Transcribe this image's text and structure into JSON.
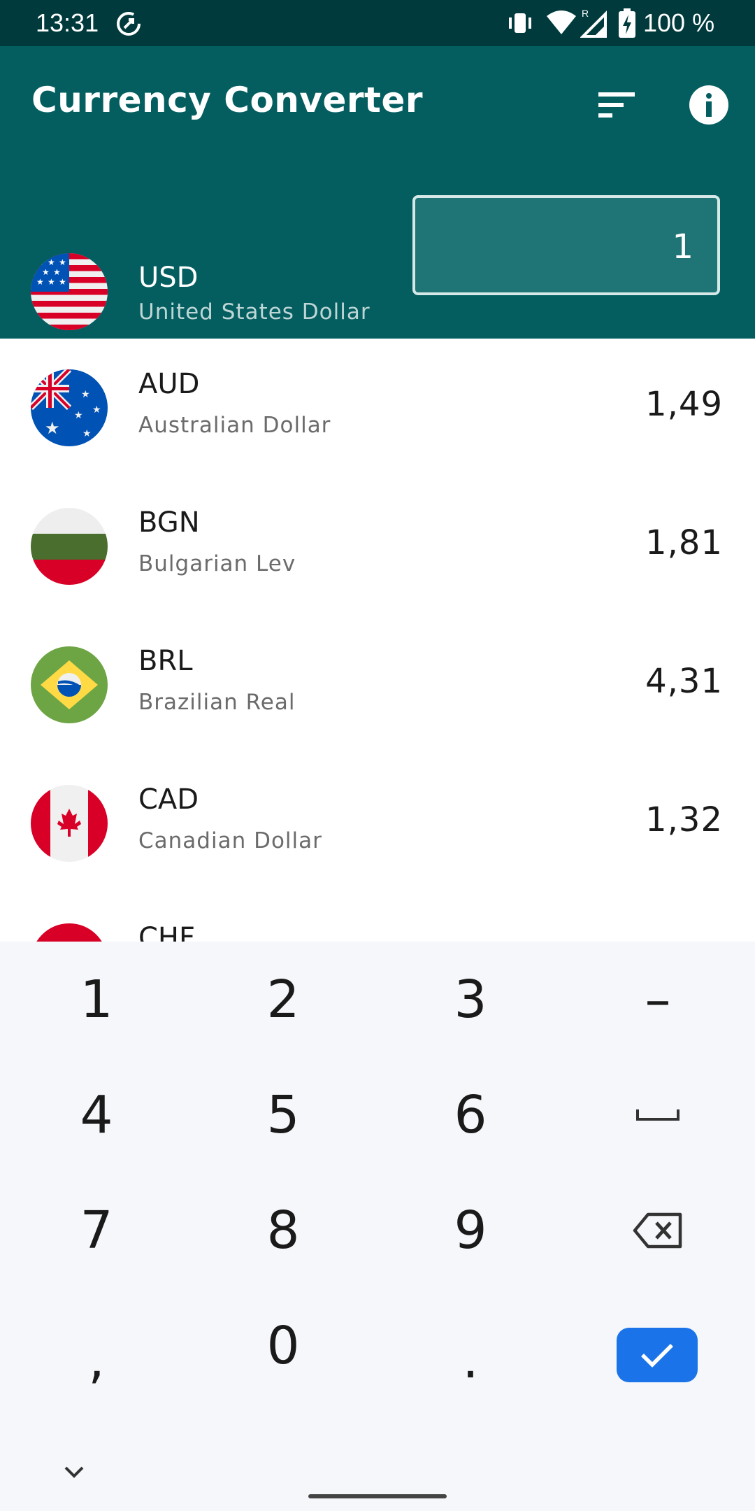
{
  "status_bar": {
    "time": "13:31",
    "battery": "100 %",
    "icons": [
      "data-saver-icon",
      "vibrate-icon",
      "wifi-icon",
      "signal-roaming-icon",
      "battery-charging-icon"
    ]
  },
  "app_bar": {
    "title": "Currency Converter",
    "actions": [
      "sort-icon",
      "info-icon"
    ],
    "color": "#045e60"
  },
  "base_currency": {
    "code": "USD",
    "name": "United States Dollar",
    "amount": "1",
    "flag": "us-flag"
  },
  "currencies": [
    {
      "code": "AUD",
      "name": "Australian Dollar",
      "value": "1,49",
      "flag": "au-flag"
    },
    {
      "code": "BGN",
      "name": "Bulgarian Lev",
      "value": "1,81",
      "flag": "bg-flag"
    },
    {
      "code": "BRL",
      "name": "Brazilian Real",
      "value": "4,31",
      "flag": "br-flag"
    },
    {
      "code": "CAD",
      "name": "Canadian Dollar",
      "value": "1,32",
      "flag": "ca-flag"
    },
    {
      "code": "CHF",
      "name": "",
      "value": "",
      "flag": "ch-flag"
    }
  ],
  "keyboard": {
    "rows": [
      [
        "1",
        "2",
        "3",
        "–"
      ],
      [
        "4",
        "5",
        "6",
        "␣"
      ],
      [
        "7",
        "8",
        "9",
        "⌫"
      ],
      [
        ",",
        "0",
        ".",
        "✓"
      ]
    ],
    "accent": "#1a73e8"
  }
}
